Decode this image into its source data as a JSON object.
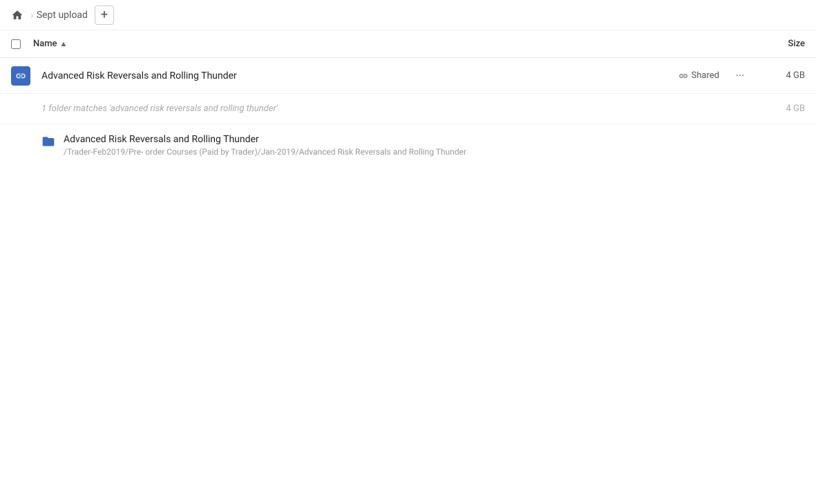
{
  "breadcrumb": {
    "home_label": "Home",
    "separator": "›",
    "folder_name": "Sept upload",
    "add_button_label": "+"
  },
  "table": {
    "name_column": "Name",
    "sort_indicator": "▲",
    "size_column": "Size"
  },
  "main_file": {
    "name": "Advanced Risk Reversals and Rolling Thunder",
    "shared_label": "Shared",
    "size": "4 GB",
    "more_label": "···"
  },
  "search_results": {
    "info_text": "1 folder matches 'advanced risk reversals and rolling thunder'",
    "size_text": "4 GB",
    "folder": {
      "name": "Advanced Risk Reversals and Rolling Thunder",
      "path": "/Trader-Feb2019/Pre- order Courses (Paid by Trader)/Jan-2019/Advanced Risk Reversals and Rolling Thunder"
    }
  }
}
